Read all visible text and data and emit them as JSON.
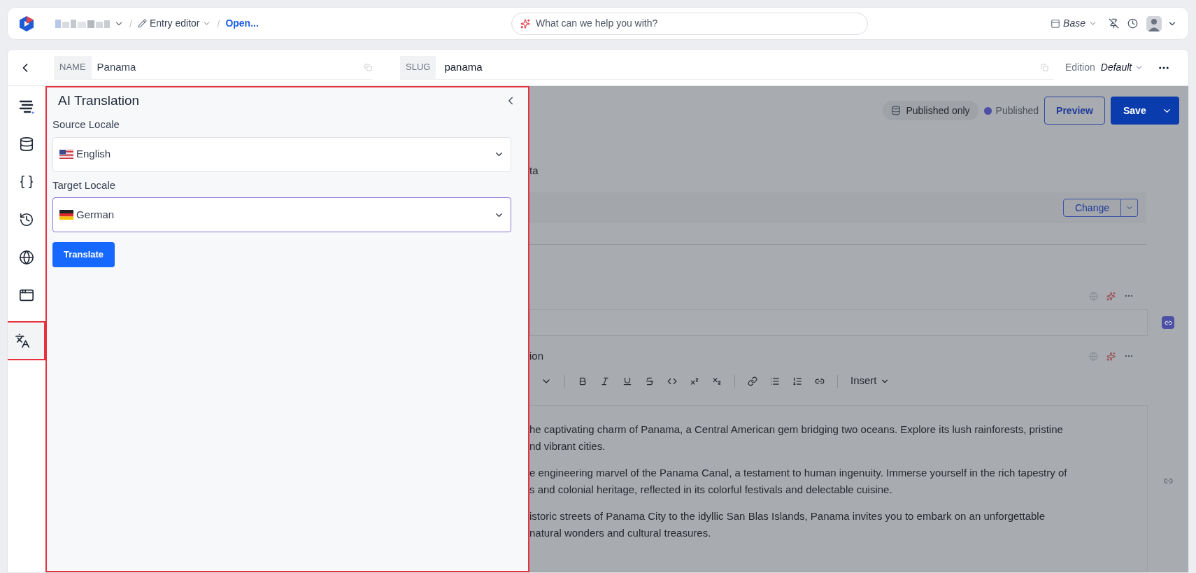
{
  "top_bar": {
    "breadcrumbs": [
      {
        "label": "Entry editor",
        "kind": "menu"
      },
      {
        "label": "Open...",
        "kind": "link"
      }
    ],
    "separator": "/",
    "search": {
      "placeholder": "What can we help you with?"
    },
    "branch": "Base"
  },
  "header": {
    "name_label": "NAME",
    "name_value": "Panama",
    "slug_label": "SLUG",
    "slug_value": "panama",
    "edition_label": "Edition",
    "edition_value": "Default"
  },
  "rail": [
    {
      "kind": "outline",
      "selected": false
    },
    {
      "kind": "database",
      "selected": false
    },
    {
      "kind": "braces",
      "selected": false
    },
    {
      "kind": "history",
      "selected": false
    },
    {
      "kind": "globe",
      "selected": false
    },
    {
      "kind": "window",
      "selected": false
    },
    {
      "kind": "translate",
      "selected": true
    }
  ],
  "panel": {
    "title": "AI Translation",
    "fields": [
      {
        "label": "Source Locale",
        "value": "English",
        "kind": "american",
        "focused": false
      },
      {
        "label": "Target Locale",
        "value": "German",
        "kind": "german",
        "focused": true
      }
    ],
    "button": "Translate"
  },
  "background": {
    "filter": "Published only",
    "status": "Published",
    "preview": "Preview",
    "save": "Save",
    "fragment_1": "ta",
    "change": "Change",
    "fragment_2": "ion",
    "insert": "Insert",
    "paragraphs": [
      [
        "he captivating charm of Panama, a Central American gem bridging two oceans. Explore its lush rainforests, pristine",
        "nd vibrant cities."
      ],
      [
        "e engineering marvel of the Panama Canal, a testament to human ingenuity. Immerse yourself in the rich tapestry of",
        "s and colonial heritage, reflected in its colorful festivals and delectable cuisine."
      ],
      [
        "istoric streets of Panama City to the idyllic San Blas Islands, Panama invites you to embark on an unforgettable",
        "natural wonders and cultural treasures."
      ]
    ]
  }
}
